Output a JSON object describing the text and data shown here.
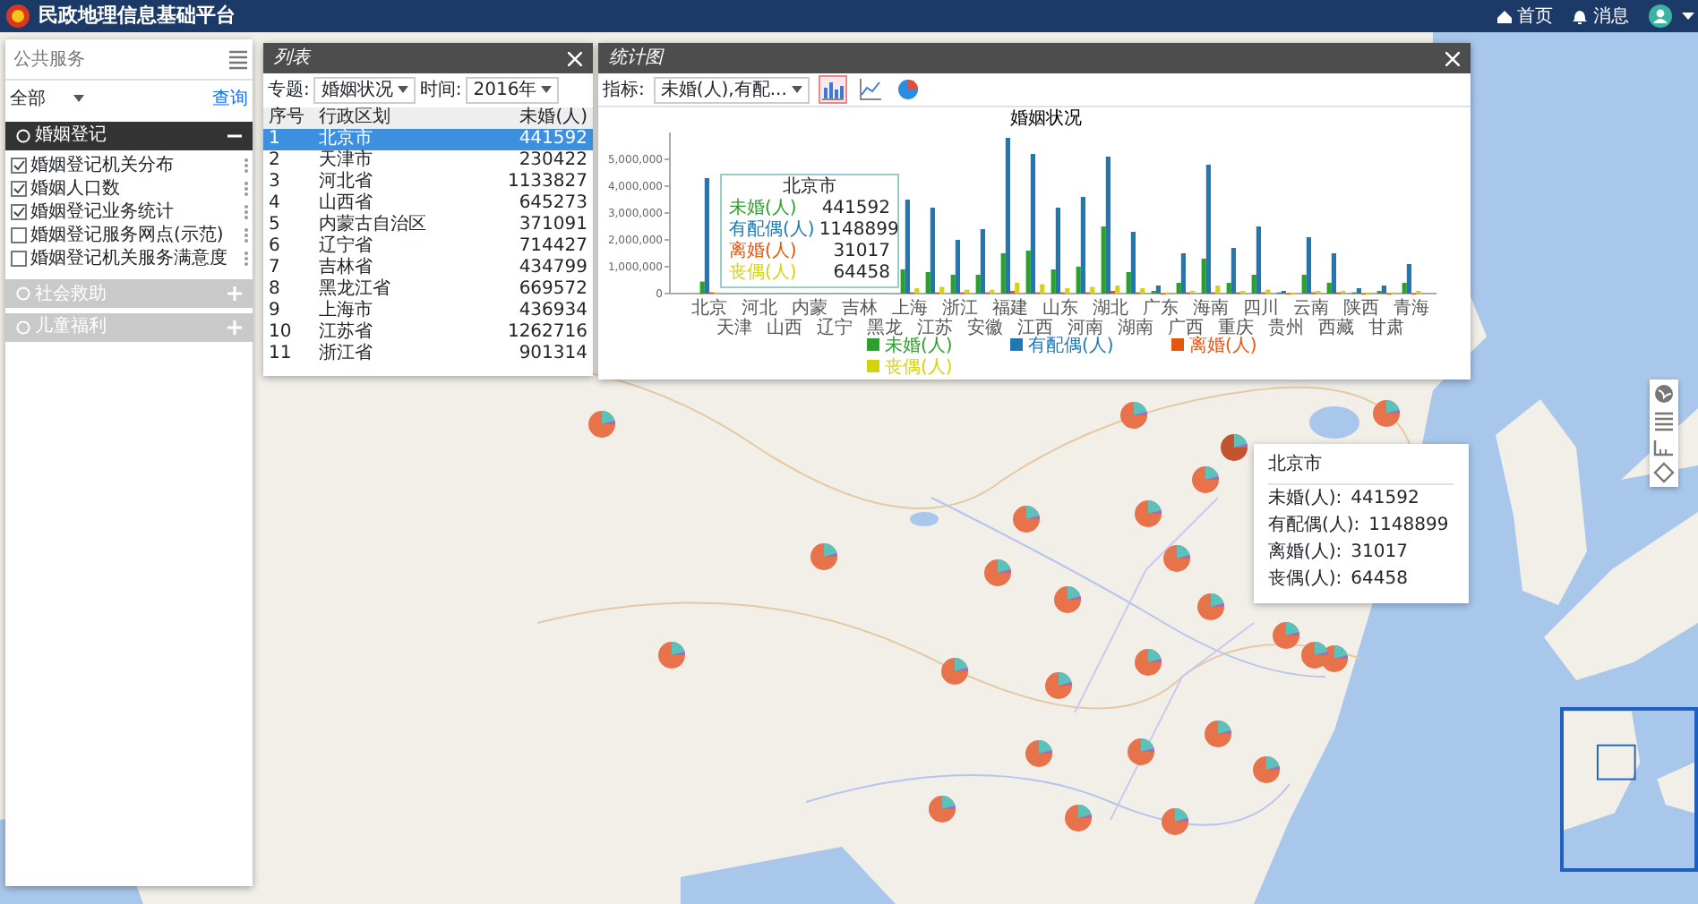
{
  "header": {
    "title": "民政地理信息基础平台",
    "nav": [
      {
        "label": "首页"
      },
      {
        "label": "消息"
      }
    ]
  },
  "sidebar": {
    "search": {
      "placeholder": "公共服务"
    },
    "filter": {
      "value": "全部"
    },
    "query_link": "查询",
    "sections": [
      {
        "title": "婚姻登记",
        "expanded": true,
        "items": [
          {
            "label": "婚姻登记机关分布",
            "checked": true
          },
          {
            "label": "婚姻人口数",
            "checked": true
          },
          {
            "label": "婚姻登记业务统计",
            "checked": true
          },
          {
            "label": "婚姻登记服务网点(示范)",
            "checked": false
          },
          {
            "label": "婚姻登记机关服务满意度",
            "checked": false
          }
        ]
      },
      {
        "title": "社会救助",
        "expanded": false
      },
      {
        "title": "儿童福利",
        "expanded": false
      }
    ]
  },
  "list_panel": {
    "title": "列表",
    "filters": [
      {
        "label": "专题:",
        "value": "婚姻状况"
      },
      {
        "label": "时间:",
        "value": "2016年"
      }
    ],
    "columns": [
      "序号",
      "行政区划",
      "未婚(人)"
    ],
    "rows": [
      {
        "cells": [
          "1",
          "北京市",
          "441592"
        ],
        "selected": true
      },
      {
        "cells": [
          "2",
          "天津市",
          "230422"
        ],
        "selected": false
      },
      {
        "cells": [
          "3",
          "河北省",
          "1133827"
        ],
        "selected": false
      },
      {
        "cells": [
          "4",
          "山西省",
          "645273"
        ],
        "selected": false
      },
      {
        "cells": [
          "5",
          "内蒙古自治区",
          "371091"
        ],
        "selected": false
      },
      {
        "cells": [
          "6",
          "辽宁省",
          "714427"
        ],
        "selected": false
      },
      {
        "cells": [
          "7",
          "吉林省",
          "434799"
        ],
        "selected": false
      },
      {
        "cells": [
          "8",
          "黑龙江省",
          "669572"
        ],
        "selected": false
      },
      {
        "cells": [
          "9",
          "上海市",
          "436934"
        ],
        "selected": false
      },
      {
        "cells": [
          "10",
          "江苏省",
          "1262716"
        ],
        "selected": false
      },
      {
        "cells": [
          "11",
          "浙江省",
          "901314"
        ],
        "selected": false
      }
    ]
  },
  "chart_panel": {
    "title": "统计图",
    "indicator": {
      "label": "指标:",
      "value": "未婚(人),有配..."
    },
    "chart_types": [
      {
        "kind": "bar",
        "selected": true
      },
      {
        "kind": "line",
        "selected": false
      },
      {
        "kind": "pie",
        "selected": false
      }
    ],
    "chart_data": {
      "type": "bar",
      "title": "婚姻状况",
      "legend": "bottom",
      "categories": [
        "北京",
        "天津",
        "河北",
        "山西",
        "内蒙",
        "辽宁",
        "吉林",
        "黑龙",
        "上海",
        "江苏",
        "浙江",
        "安徽",
        "福建",
        "江西",
        "山东",
        "河南",
        "湖北",
        "湖南",
        "广东",
        "广西",
        "海南",
        "重庆",
        "四川",
        "贵州",
        "云南",
        "西藏",
        "陕西",
        "甘肃",
        "青海"
      ],
      "series": [
        {
          "name": "未婚(人)",
          "color": "#2ca02c",
          "values": [
            450000,
            null,
            null,
            null,
            null,
            null,
            null,
            null,
            900000,
            800000,
            700000,
            700000,
            1500000,
            1600000,
            900000,
            1000000,
            2500000,
            800000,
            100000,
            400000,
            1300000,
            400000,
            700000,
            50000,
            700000,
            400000,
            50000,
            100000,
            400000
          ]
        },
        {
          "name": "有配偶(人)",
          "color": "#1f78b4",
          "values": [
            4300000,
            null,
            null,
            null,
            null,
            null,
            null,
            null,
            3500000,
            3200000,
            2000000,
            2400000,
            5800000,
            5200000,
            3200000,
            3600000,
            5100000,
            2300000,
            300000,
            1500000,
            4800000,
            1700000,
            2500000,
            100000,
            2100000,
            1500000,
            200000,
            300000,
            1100000
          ]
        },
        {
          "name": "离婚(人)",
          "color": "#e6550d",
          "values": [
            50000,
            null,
            null,
            null,
            null,
            null,
            null,
            null,
            50000,
            50000,
            50000,
            50000,
            100000,
            50000,
            50000,
            50000,
            100000,
            50000,
            0,
            50000,
            50000,
            50000,
            50000,
            0,
            50000,
            50000,
            0,
            0,
            0
          ]
        },
        {
          "name": "丧偶(人)",
          "color": "#d4d40a",
          "values": [
            50000,
            null,
            null,
            null,
            null,
            null,
            null,
            null,
            200000,
            250000,
            150000,
            150000,
            400000,
            350000,
            200000,
            250000,
            300000,
            200000,
            50000,
            100000,
            300000,
            100000,
            150000,
            0,
            100000,
            100000,
            0,
            50000,
            100000
          ]
        }
      ],
      "ylim": [
        0,
        6000000
      ],
      "yticks": [
        {
          "value": 0,
          "label": "0"
        },
        {
          "value": 1000000,
          "label": "1,000,000"
        },
        {
          "value": 2000000,
          "label": "2,000,000"
        },
        {
          "value": 3000000,
          "label": "3,000,000"
        },
        {
          "value": 4000000,
          "label": "4,000,000"
        },
        {
          "value": 5000000,
          "label": "5,000,000"
        }
      ]
    },
    "hover": {
      "title": "北京市",
      "rows": [
        {
          "label": "未婚(人)",
          "value": "441592"
        },
        {
          "label": "有配偶(人)",
          "value": "1148899"
        },
        {
          "label": "离婚(人)",
          "value": "31017"
        },
        {
          "label": "丧偶(人)",
          "value": "64458"
        }
      ]
    }
  },
  "map": {
    "tools": [
      {
        "kind": "globe"
      },
      {
        "kind": "list"
      },
      {
        "kind": "ruler"
      },
      {
        "kind": "clear"
      }
    ],
    "popup": {
      "title": "北京市",
      "rows": [
        {
          "label": "未婚(人):",
          "value": "441592"
        },
        {
          "label": "有配偶(人):",
          "value": "1148899"
        },
        {
          "label": "离婚(人):",
          "value": "31017"
        },
        {
          "label": "丧偶(人):",
          "value": "64458"
        }
      ]
    }
  }
}
